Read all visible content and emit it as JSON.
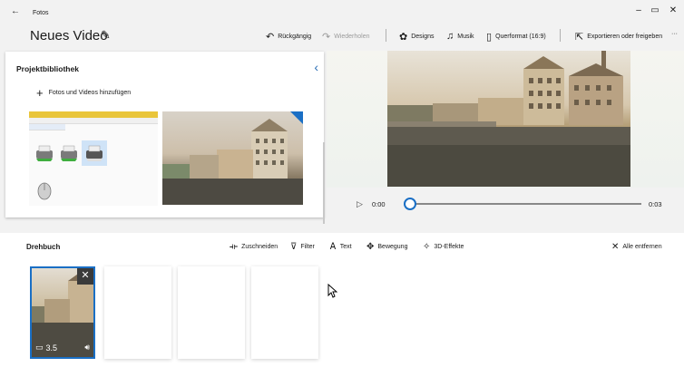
{
  "titlebar": {
    "app_name": "Fotos",
    "back_icon": "arrow-left-icon",
    "minimize": "–",
    "maximize": "▭",
    "close": "✕"
  },
  "project": {
    "title": "Neues Video",
    "edit_icon": "pencil-icon"
  },
  "toolbar": {
    "undo": "Rückgängig",
    "redo": "Wiederholen",
    "themes": "Designs",
    "music": "Musik",
    "aspect": "Querformat (16:9)",
    "export": "Exportieren oder freigeben",
    "more": "···"
  },
  "library": {
    "title": "Projektbibliothek",
    "add_label": "Fotos und Videos hinzufügen",
    "collapse_icon": "chevron-left-icon"
  },
  "player": {
    "current_time": "0:00",
    "end_time": "0:03",
    "progress": 0.0
  },
  "storyboard": {
    "title": "Drehbuch",
    "tools": {
      "trim": "Zuschneiden",
      "filter": "Filter",
      "text": "Text",
      "motion": "Bewegung",
      "effects3d": "3D-Effekte"
    },
    "remove_all": "Alle entfernen",
    "clip": {
      "duration": "3.5"
    }
  },
  "colors": {
    "accent": "#1a6fc5"
  }
}
